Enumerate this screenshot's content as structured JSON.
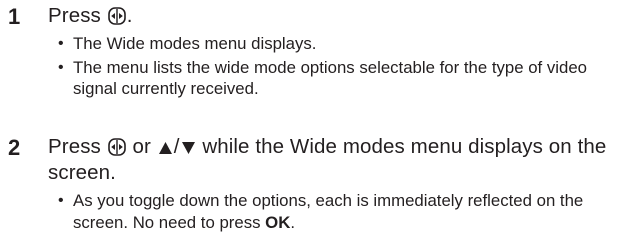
{
  "steps": [
    {
      "number": "1",
      "title_prefix": "Press",
      "title_icon": "wide-button-icon",
      "title_suffix": ".",
      "bullets": [
        "The Wide modes menu displays.",
        "The menu lists the wide mode options selectable for the type of video signal currently received."
      ]
    },
    {
      "number": "2",
      "title_prefix": "Press",
      "title_icon": "wide-button-icon",
      "title_or": "or",
      "title_up_icon": "up-triangle-icon",
      "title_slash": "/",
      "title_down_icon": "down-triangle-icon",
      "title_rest": "while the Wide modes menu displays on the screen.",
      "bullets": [
        {
          "text_before": "As you toggle down the options, each is immediately reflected on the screen. No need to press",
          "bold": "OK",
          "text_after": "."
        }
      ]
    }
  ]
}
